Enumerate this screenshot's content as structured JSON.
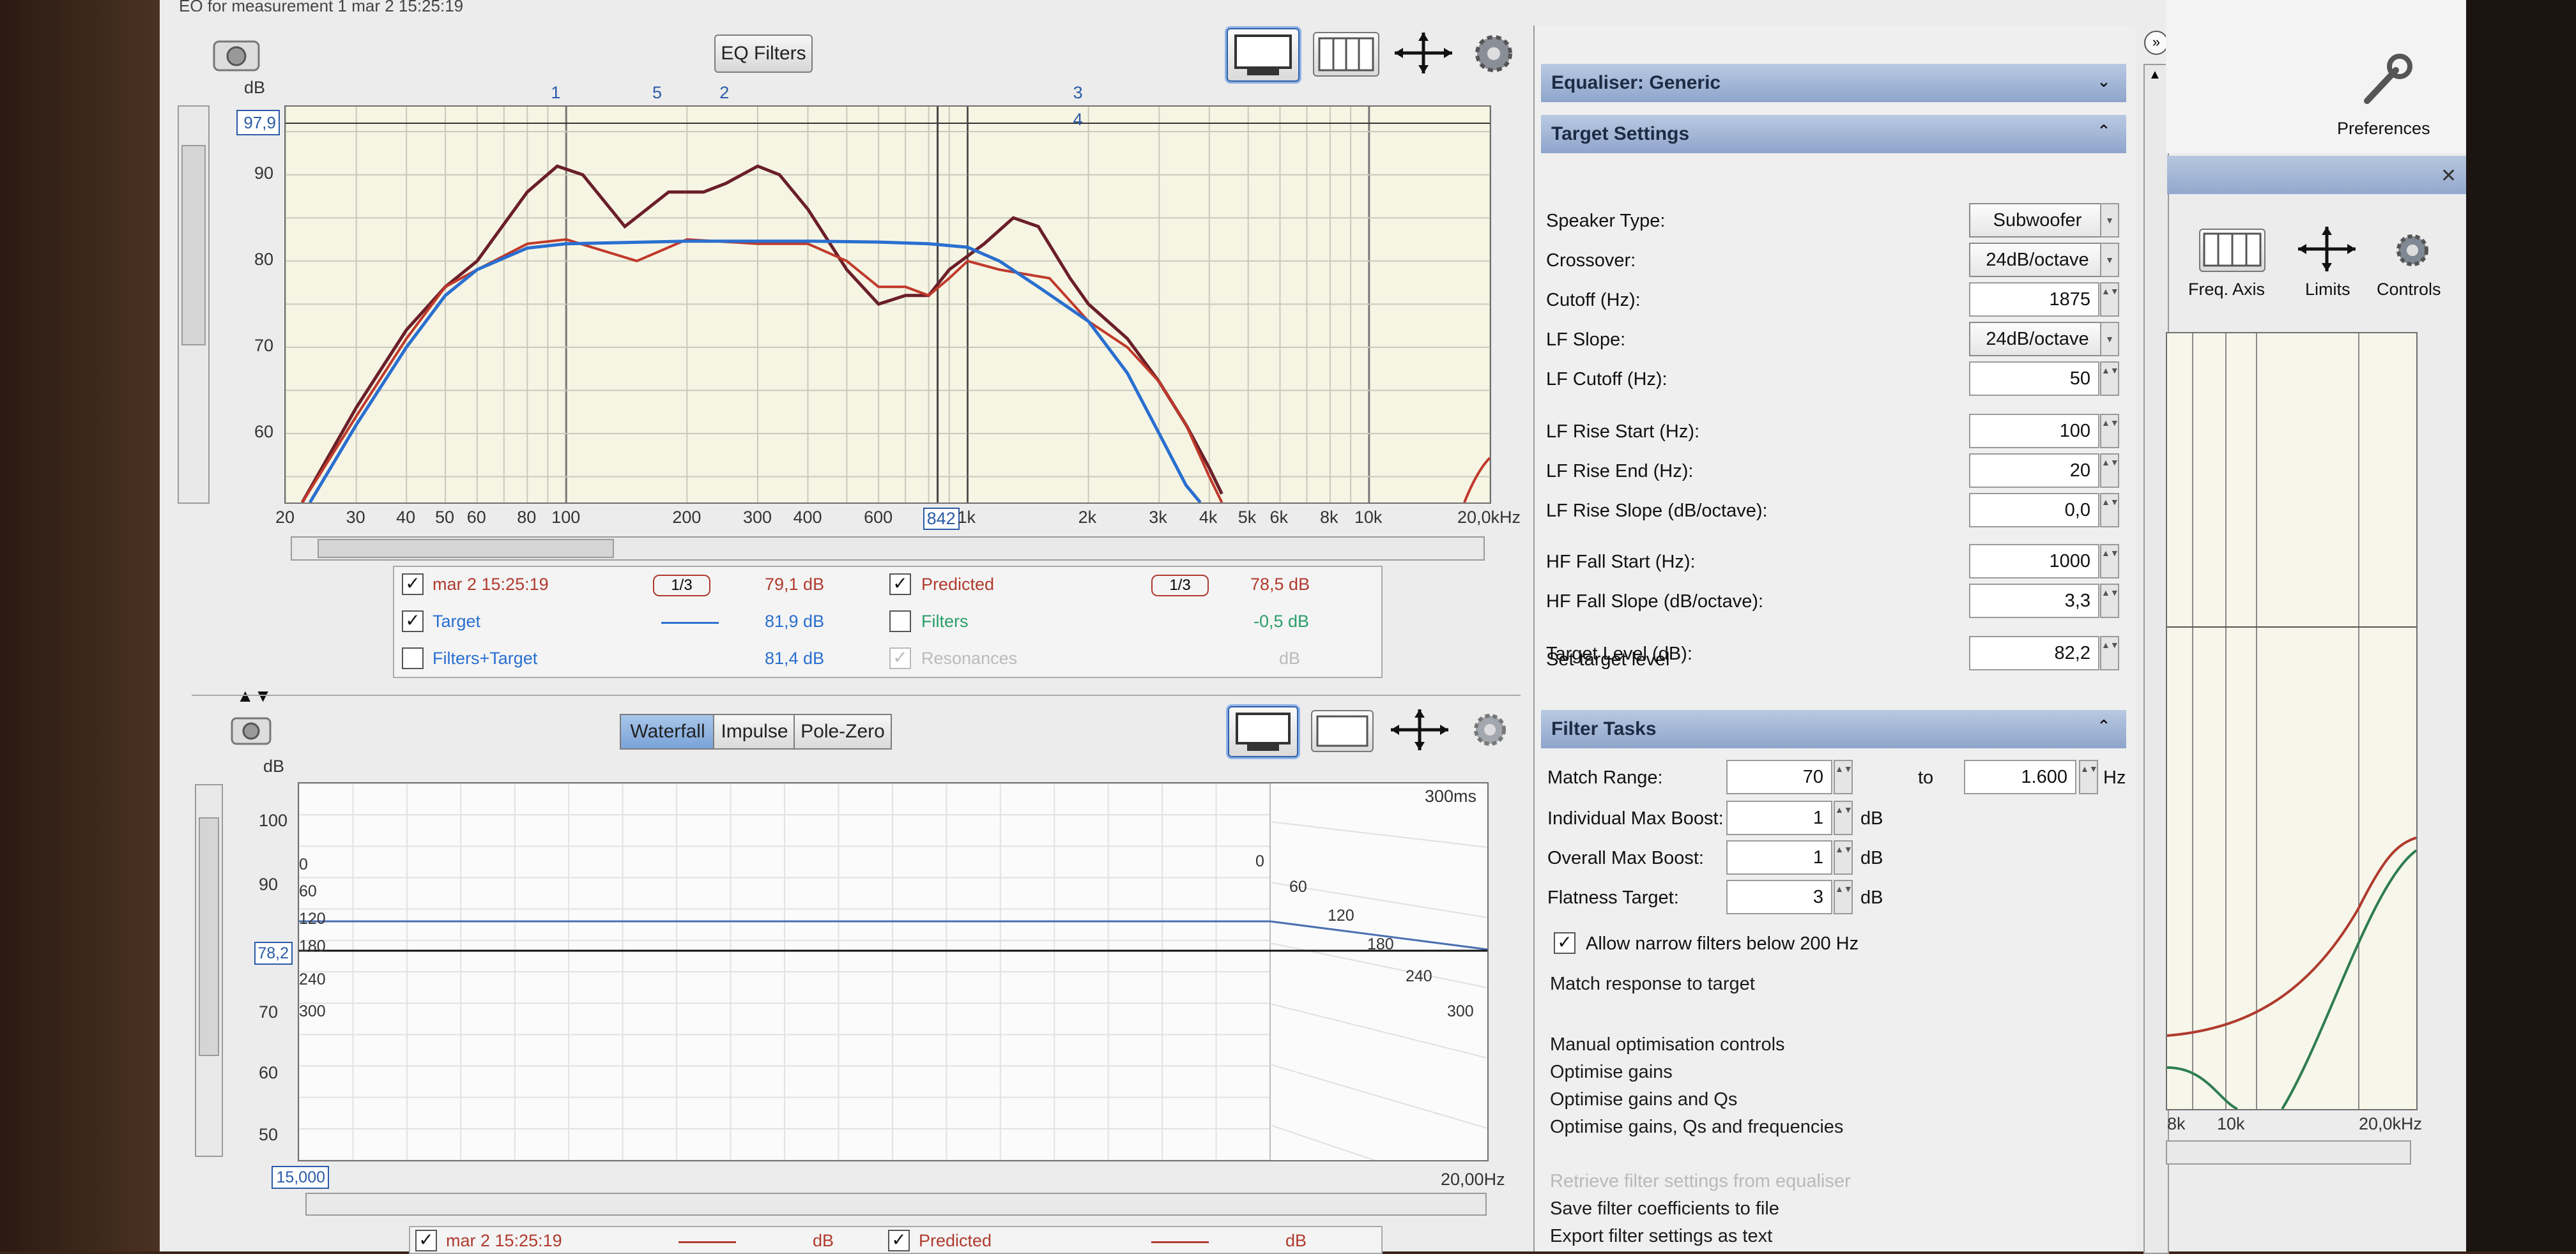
{
  "window": {
    "title": "EQ for measurement 1 mar 2 15:25:19"
  },
  "toolbar": {
    "eq_filters": "EQ Filters"
  },
  "top_graph": {
    "y_unit": "dB",
    "y_value_box": "97,9",
    "y_ticks": [
      "90",
      "80",
      "70",
      "60"
    ],
    "x_ticks": [
      "20",
      "30",
      "40",
      "50",
      "60",
      "80",
      "100",
      "200",
      "300",
      "400",
      "600",
      "842",
      "1k",
      "2k",
      "3k",
      "4k",
      "5k",
      "6k",
      "8k",
      "10k",
      "20,0kHz"
    ],
    "filter_markers": [
      "1",
      "5",
      "2",
      "3",
      "4"
    ]
  },
  "legend": {
    "rows": [
      {
        "name": "mar 2 15:25:19",
        "smoothing": "1/3",
        "value": "79,1 dB",
        "checked": true,
        "color": "#b03a2e"
      },
      {
        "name": "Target",
        "value": "81,9 dB",
        "checked": true,
        "color": "#2a6fd0"
      },
      {
        "name": "Filters+Target",
        "value": "81,4 dB",
        "checked": false,
        "color": "#2a6fd0"
      }
    ],
    "rows_right": [
      {
        "name": "Predicted",
        "smoothing": "1/3",
        "value": "78,5 dB",
        "checked": true,
        "color": "#b03a2e"
      },
      {
        "name": "Filters",
        "value": "-0,5 dB",
        "checked": false,
        "color": "#2a9d6a"
      },
      {
        "name": "Resonances",
        "value": "dB",
        "checked": true,
        "disabled": true
      }
    ]
  },
  "bottom_graph": {
    "tabs": [
      "Waterfall",
      "Impulse",
      "Pole-Zero"
    ],
    "active_tab": "Waterfall",
    "y_unit": "dB",
    "y_ticks": [
      "100",
      "90",
      "80",
      "70",
      "60",
      "50"
    ],
    "y_value_box": "78,2",
    "time_label": "300ms",
    "x_start_box": "15,000",
    "x_end_label": "20,00Hz",
    "slice_labels_left": [
      "0",
      "60",
      "120",
      "180",
      "240",
      "300"
    ],
    "slice_labels_right": [
      "0",
      "60",
      "120",
      "180",
      "240",
      "300"
    ],
    "legend_row": {
      "name": "mar 2 15:25:19",
      "value": "dB",
      "predicted": "Predicted",
      "predicted_value": "dB"
    }
  },
  "equaliser_header": "Equaliser: Generic",
  "target_settings": {
    "header": "Target Settings",
    "fields": [
      {
        "label": "Speaker Type:",
        "value": "Subwoofer",
        "kind": "combo"
      },
      {
        "label": "Crossover:",
        "value": "24dB/octave",
        "kind": "combo"
      },
      {
        "label": "Cutoff (Hz):",
        "value": "1875",
        "kind": "spin"
      },
      {
        "label": "LF Slope:",
        "value": "24dB/octave",
        "kind": "combo"
      },
      {
        "label": "LF Cutoff (Hz):",
        "value": "50",
        "kind": "spin"
      },
      {
        "label": "LF Rise Start (Hz):",
        "value": "100",
        "kind": "spin"
      },
      {
        "label": "LF Rise End (Hz):",
        "value": "20",
        "kind": "spin"
      },
      {
        "label": "LF Rise Slope (dB/octave):",
        "value": "0,0",
        "kind": "spin"
      },
      {
        "label": "HF Fall Start (Hz):",
        "value": "1000",
        "kind": "spin"
      },
      {
        "label": "HF Fall Slope (dB/octave):",
        "value": "3,3",
        "kind": "spin"
      },
      {
        "label": "Target Level (dB):",
        "value": "82,2",
        "kind": "spin"
      }
    ],
    "set_target": "Set target level"
  },
  "filter_tasks": {
    "header": "Filter Tasks",
    "match_range_label": "Match Range:",
    "match_from": "70",
    "to_label": "to",
    "match_to": "1.600",
    "hz": "Hz",
    "ind_boost_label": "Individual Max Boost:",
    "ind_boost": "1",
    "overall_boost_label": "Overall Max Boost:",
    "overall_boost": "1",
    "flatness_label": "Flatness Target:",
    "flatness": "3",
    "db": "dB",
    "allow_narrow": "Allow narrow filters below 200 Hz",
    "match_response": "Match response to target",
    "manual": "Manual optimisation controls",
    "opt_gains": "Optimise gains",
    "opt_gains_qs": "Optimise gains and Qs",
    "opt_all": "Optimise gains, Qs and frequencies",
    "retrieve": "Retrieve filter settings from equaliser",
    "save_coeff": "Save filter coefficients to file",
    "export": "Export filter settings as text"
  },
  "right_pane": {
    "preferences": "Preferences",
    "freq_axis": "Freq. Axis",
    "limits": "Limits",
    "controls": "Controls",
    "x_ticks": [
      "8k",
      "10k",
      "20,0kHz"
    ]
  },
  "colors": {
    "measurement": "#b03a2e",
    "target": "#2a6fd0",
    "predicted": "#6b1f28",
    "header_bg": "#9fb4d6"
  }
}
